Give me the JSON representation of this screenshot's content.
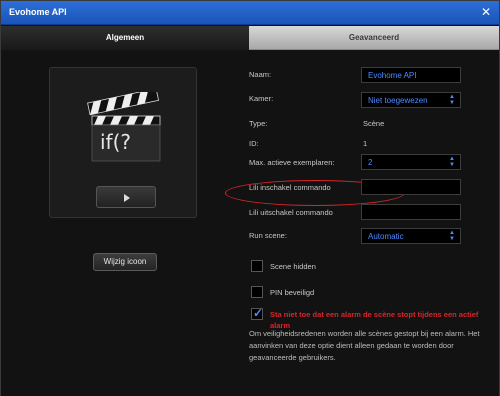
{
  "window": {
    "title": "Evohome API",
    "close_glyph": "✕"
  },
  "tabs": [
    {
      "label": "Algemeen",
      "active": true
    },
    {
      "label": "Geavanceerd",
      "active": false
    }
  ],
  "icon_panel": {
    "icon": "scene-clapperboard-icon",
    "icon_text": "if(?",
    "change_button_label": "Wijzig icoon"
  },
  "form": {
    "name_label": "Naam:",
    "name_value": "Evohome API",
    "room_label": "Kamer:",
    "room_value": "Niet toegewezen",
    "type_label": "Type:",
    "type_value": "Scène",
    "id_label": "ID:",
    "id_value": "1",
    "max_instances_label": "Max. actieve exemplaren:",
    "max_instances_value": "2",
    "lili_on_label": "Lili inschakel commando",
    "lili_on_value": "",
    "lili_off_label": "Lili uitschakel commando",
    "lili_off_value": "",
    "run_label": "Run scene:",
    "run_value": "Automatic"
  },
  "checkboxes": {
    "hidden_label": "Scene hidden",
    "pin_label": "PIN beveiligd",
    "alarm_label": "Sta niet toe dat een alarm de scène stopt tijdens een actief alarm"
  },
  "note": "Om veiligheidsredenen worden alle scènes gestopt bij een alarm. Het aanvinken van deze optie dient alleen gedaan te worden door geavanceerde gebruikers.",
  "colors": {
    "accent": "#4d8bff",
    "titlebar": "#2d6fd8",
    "highlight": "#d8262a"
  }
}
